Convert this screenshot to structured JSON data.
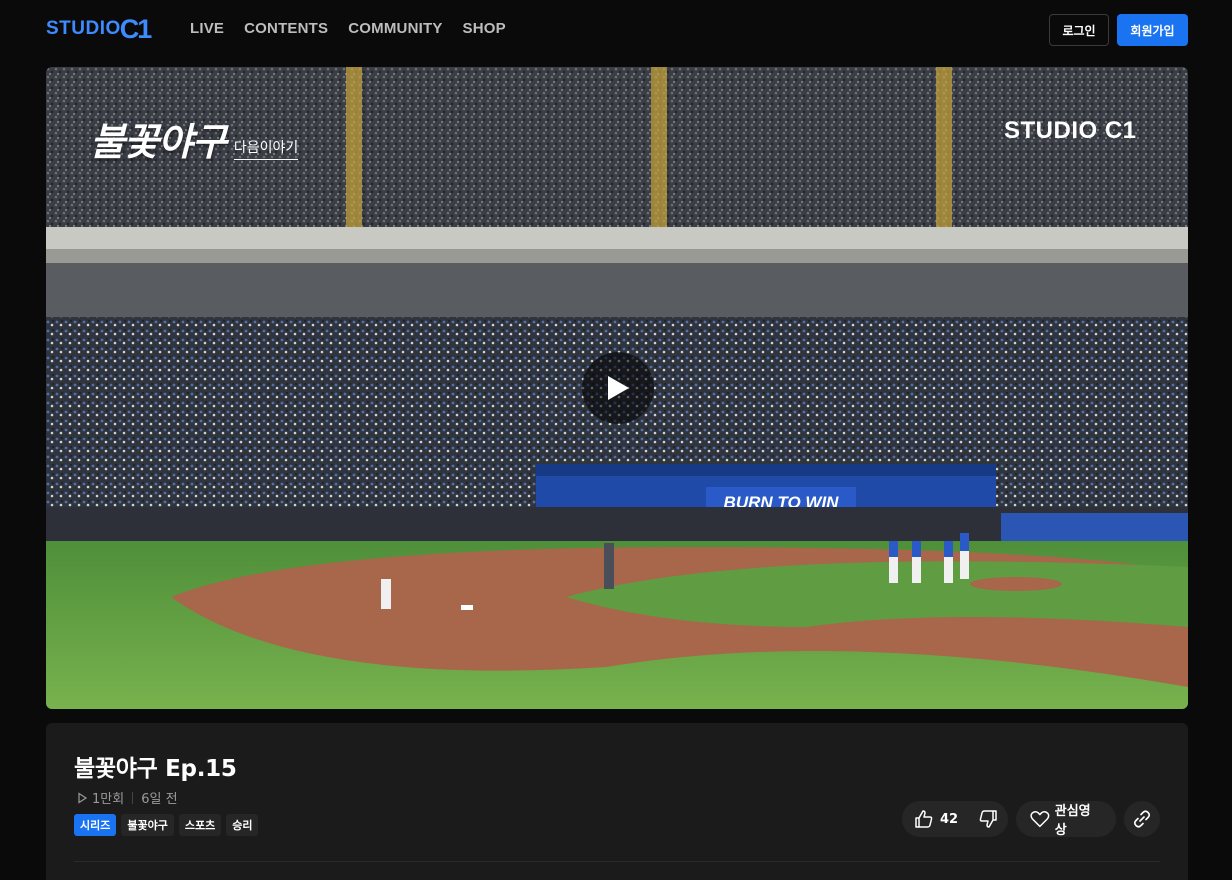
{
  "brand": {
    "logo_text": "STUDIO",
    "logo_mark": "C1"
  },
  "nav": [
    "LIVE",
    "CONTENTS",
    "COMMUNITY",
    "SHOP"
  ],
  "auth": {
    "login_label": "로그인",
    "signup_label": "회원가입"
  },
  "player": {
    "overlay_title": "불꽃야구",
    "overlay_subtitle": "다음이야기",
    "overlay_logo": "STUDIO C1",
    "banner_text": "BURN TO WIN",
    "play_icon": "play-icon"
  },
  "video": {
    "title": "불꽃야구 Ep.15",
    "views": "1만회",
    "posted": "6일 전",
    "tags": [
      {
        "label": "시리즈",
        "primary": true
      },
      {
        "label": "불꽃야구",
        "primary": false
      },
      {
        "label": "스포츠",
        "primary": false
      },
      {
        "label": "승리",
        "primary": false
      }
    ],
    "likes": "42",
    "favorite_label": "관심영상"
  },
  "colors": {
    "accent": "#1a73f0",
    "background": "#0a0a0a",
    "panel": "#1b1b1b",
    "pill": "#262626"
  }
}
